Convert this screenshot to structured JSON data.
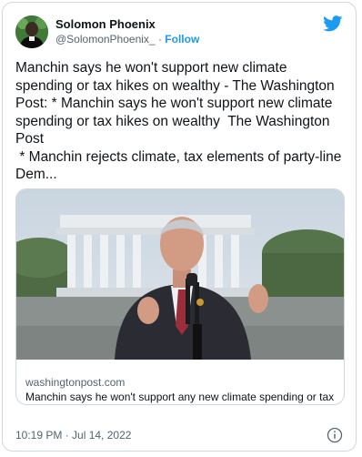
{
  "author": {
    "display_name": "Solomon Phoenix",
    "handle": "@SolomonPhoenix_",
    "separator": "·",
    "follow_label": "Follow"
  },
  "tweet": {
    "text": "Manchin says he won't support new climate spending or tax hikes on wealthy - The Washington Post: * Manchin says he won't support new climate spending or tax hikes on wealthy  The Washington Post\n * Manchin rejects climate, tax elements of party-line Dem..."
  },
  "link_card": {
    "domain": "washingtonpost.com",
    "headline": "Manchin says he won't support any new climate spending or tax hikes"
  },
  "timestamp": "10:19 PM · Jul 14, 2022",
  "colors": {
    "accent": "#1d9bf0",
    "text": "#0f1419",
    "muted": "#536471",
    "border": "#cfd9de"
  },
  "icons": {
    "logo": "twitter-bird-icon",
    "info": "info-icon"
  }
}
